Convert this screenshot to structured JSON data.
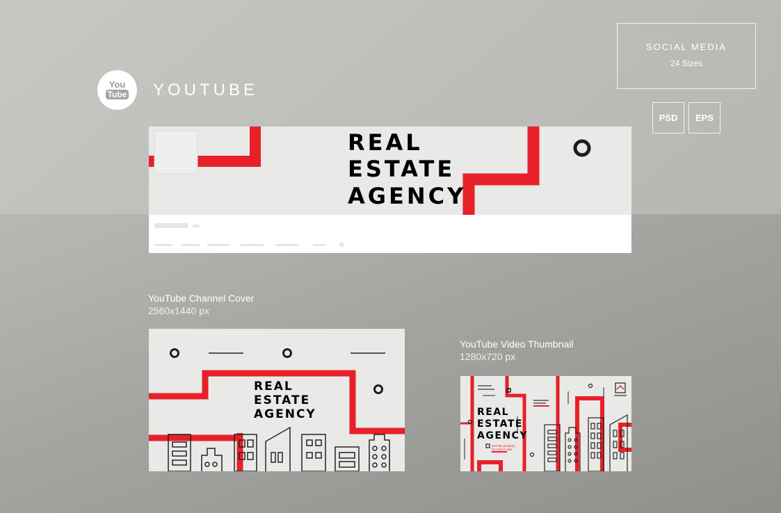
{
  "header": {
    "logo": {
      "you": "You",
      "tube": "Tube",
      "icon": "youtube-icon"
    },
    "title": "YOUTUBE"
  },
  "social_box": {
    "title": "SOCIAL MEDIA",
    "sizes": "24 Sizes"
  },
  "badges": [
    "PSD",
    "EPS"
  ],
  "cover": {
    "headline": [
      "REAL",
      "ESTATE",
      "AGENCY"
    ]
  },
  "channel_cover": {
    "label": "YouTube Channel Cover",
    "size": "2560x1440 px",
    "headline": [
      "REAL",
      "ESTATE",
      "AGENCY"
    ]
  },
  "thumbnail": {
    "label": "YouTube Video Thumbnail",
    "size": "1280x720 px",
    "headline": [
      "REAL",
      "ESTATE",
      "AGENCY"
    ],
    "tagline": [
      "Sort the property",
      "for rent or sale"
    ]
  },
  "colors": {
    "accent": "#e8202a",
    "panel": "#e9e9e7",
    "ink": "#1d1d1d"
  }
}
